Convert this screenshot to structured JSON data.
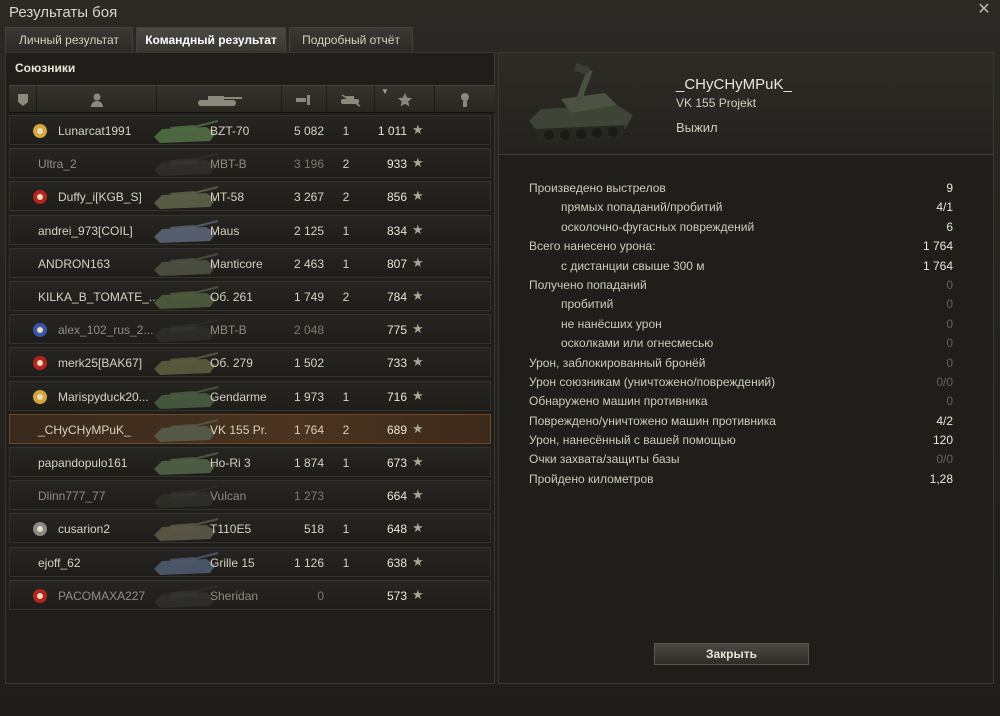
{
  "window": {
    "title": "Результаты боя"
  },
  "tabs": [
    {
      "label": "Личный результат"
    },
    {
      "label": "Командный результат"
    },
    {
      "label": "Подробный отчёт"
    }
  ],
  "left": {
    "title": "Союзники",
    "header_icons": [
      "platoon-icon",
      "player-icon",
      "tank-icon",
      "damage-icon",
      "kills-icon",
      "xp-star-icon",
      "medal-icon"
    ],
    "rows": [
      {
        "name": "Lunarcat1991",
        "badge": "gold",
        "vehicle": "BZT-70",
        "damage": "5 082",
        "kills": "1",
        "xp": "1 011",
        "dead": false
      },
      {
        "name": "Ultra_2",
        "badge": "",
        "vehicle": "MBT-B",
        "damage": "3 196",
        "kills": "2",
        "xp": "933",
        "dead": true
      },
      {
        "name": "Duffy_i[KGB_S]",
        "badge": "red",
        "vehicle": "MT-58",
        "damage": "3 267",
        "kills": "2",
        "xp": "856",
        "dead": false
      },
      {
        "name": "andrei_973[COIL]",
        "badge": "",
        "vehicle": "Maus",
        "damage": "2 125",
        "kills": "1",
        "xp": "834",
        "dead": false
      },
      {
        "name": "ANDRON163",
        "badge": "",
        "vehicle": "Manticore",
        "damage": "2 463",
        "kills": "1",
        "xp": "807",
        "dead": false
      },
      {
        "name": "KILKA_B_TOMATE_...",
        "badge": "",
        "vehicle": "Об. 261",
        "damage": "1 749",
        "kills": "2",
        "xp": "784",
        "dead": false
      },
      {
        "name": "alex_102_rus_2...",
        "badge": "blue",
        "vehicle": "MBT-B",
        "damage": "2 048",
        "kills": "",
        "xp": "775",
        "dead": true
      },
      {
        "name": "merk25[BAK67]",
        "badge": "red",
        "vehicle": "Об. 279",
        "damage": "1 502",
        "kills": "",
        "xp": "733",
        "dead": false
      },
      {
        "name": "Marispyduck20...",
        "badge": "gold",
        "vehicle": "Gendarme",
        "damage": "1 973",
        "kills": "1",
        "xp": "716",
        "dead": false
      },
      {
        "name": "_CHyCHyMPuK_",
        "badge": "",
        "vehicle": "VK 155 Pr.",
        "damage": "1 764",
        "kills": "2",
        "xp": "689",
        "dead": false,
        "selected": true
      },
      {
        "name": "papandopulo161",
        "badge": "",
        "vehicle": "Ho-Ri 3",
        "damage": "1 874",
        "kills": "1",
        "xp": "673",
        "dead": false
      },
      {
        "name": "Dlinn777_77",
        "badge": "",
        "vehicle": "Vulcan",
        "damage": "1 273",
        "kills": "",
        "xp": "664",
        "dead": true
      },
      {
        "name": "cusarion2",
        "badge": "pirate",
        "vehicle": "T110E5",
        "damage": "518",
        "kills": "1",
        "xp": "648",
        "dead": false
      },
      {
        "name": "ejoff_62",
        "badge": "",
        "vehicle": "Grille 15",
        "damage": "1 126",
        "kills": "1",
        "xp": "638",
        "dead": false
      },
      {
        "name": "PACOMAXA227",
        "badge": "red",
        "vehicle": "Sheridan",
        "damage": "0",
        "kills": "",
        "xp": "573",
        "dead": true
      }
    ]
  },
  "right": {
    "player_name": "_CHyCHyMPuK_",
    "vehicle_full": "VK 155 Projekt",
    "status": "Выжил",
    "stats": [
      {
        "label": "Произведено выстрелов",
        "value": "9",
        "sub": false,
        "zero": false
      },
      {
        "label": "прямых попаданий/пробитий",
        "value": "4/1",
        "sub": true,
        "zero": false
      },
      {
        "label": "осколочно-фугасных повреждений",
        "value": "6",
        "sub": true,
        "zero": false
      },
      {
        "label": "Всего нанесено урона:",
        "value": "1 764",
        "sub": false,
        "zero": false
      },
      {
        "label": "с дистанции свыше 300 м",
        "value": "1 764",
        "sub": true,
        "zero": false
      },
      {
        "label": "Получено попаданий",
        "value": "0",
        "sub": false,
        "zero": true
      },
      {
        "label": "пробитий",
        "value": "0",
        "sub": true,
        "zero": true
      },
      {
        "label": "не нанёсших урон",
        "value": "0",
        "sub": true,
        "zero": true
      },
      {
        "label": "осколками или огнесмесью",
        "value": "0",
        "sub": true,
        "zero": true
      },
      {
        "label": "Урон, заблокированный бронёй",
        "value": "0",
        "sub": false,
        "zero": true
      },
      {
        "label": "Урон союзникам (уничтожено/повреждений)",
        "value": "0/0",
        "sub": false,
        "zero": true
      },
      {
        "label": "Обнаружено машин противника",
        "value": "0",
        "sub": false,
        "zero": true
      },
      {
        "label": "Повреждено/уничтожено машин противника",
        "value": "4/2",
        "sub": false,
        "zero": false
      },
      {
        "label": "Урон, нанесённый с вашей помощью",
        "value": "120",
        "sub": false,
        "zero": false
      },
      {
        "label": "Очки захвата/защиты базы",
        "value": "0/0",
        "sub": false,
        "zero": true
      },
      {
        "label": "Пройдено километров",
        "value": "1,28",
        "sub": false,
        "zero": false
      }
    ],
    "close_label": "Закрыть"
  }
}
